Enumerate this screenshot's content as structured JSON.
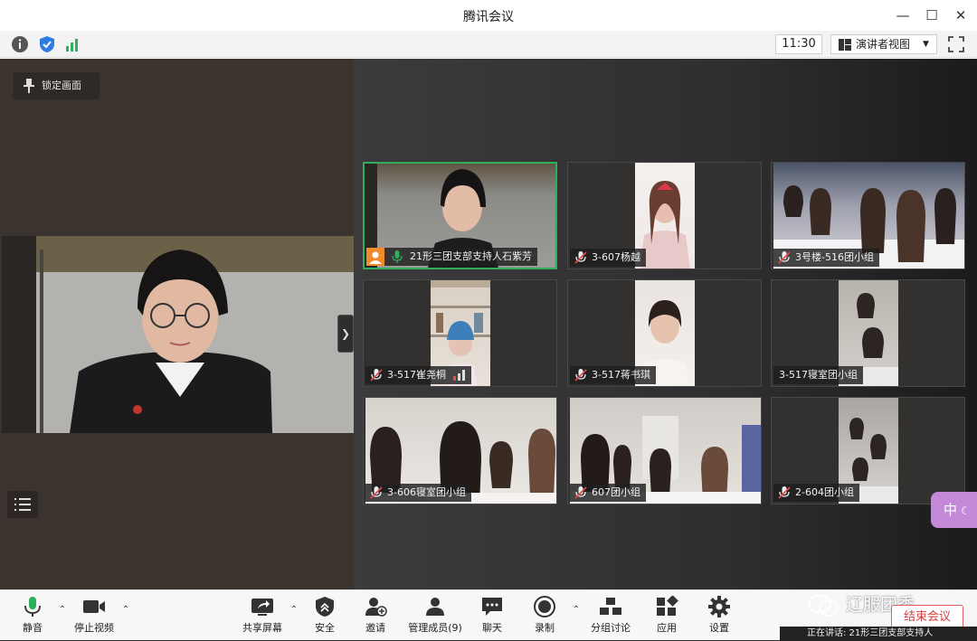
{
  "app": {
    "title": "腾讯会议",
    "colors": {
      "accent_green": "#2fae5c",
      "end_red": "#d23c3c",
      "zh_badge": "#c48ad9"
    }
  },
  "infobar": {
    "time": "11:30",
    "view_mode": "演讲者视图",
    "icons": [
      "info-icon",
      "shield-icon",
      "signal-icon",
      "fullscreen-icon"
    ]
  },
  "main": {
    "lock_label": "锁定画面"
  },
  "grid": {
    "tiles": [
      {
        "name": "21形三团支部支持人石紫芳",
        "active": true,
        "mic": "on",
        "host": true
      },
      {
        "name": "3-607杨越",
        "active": false,
        "mic": "muted"
      },
      {
        "name": "3号楼-516团小组",
        "active": false,
        "mic": "muted"
      },
      {
        "name": "3-517崔尧桐",
        "active": false,
        "mic": "muted",
        "signal": true
      },
      {
        "name": "3-517蒋书琪",
        "active": false,
        "mic": "muted"
      },
      {
        "name": "3-517寝室团小组",
        "active": false,
        "mic": "none"
      },
      {
        "name": "3-606寝室团小组",
        "active": false,
        "mic": "muted"
      },
      {
        "name": "607团小组",
        "active": false,
        "mic": "muted"
      },
      {
        "name": "2-604团小组",
        "active": false,
        "mic": "muted"
      }
    ]
  },
  "ime_badge": "中",
  "toolbar": {
    "mute": "静音",
    "stop_video": "停止视频",
    "share_screen": "共享屏幕",
    "security": "安全",
    "invite": "邀请",
    "manage_members": "管理成员(9)",
    "chat": "聊天",
    "record": "录制",
    "breakout": "分组讨论",
    "apps": "应用",
    "settings": "设置",
    "end_meeting": "结束会议",
    "watermark": "辽服团委",
    "speaking": "正在讲话: 21形三团支部支持人"
  }
}
